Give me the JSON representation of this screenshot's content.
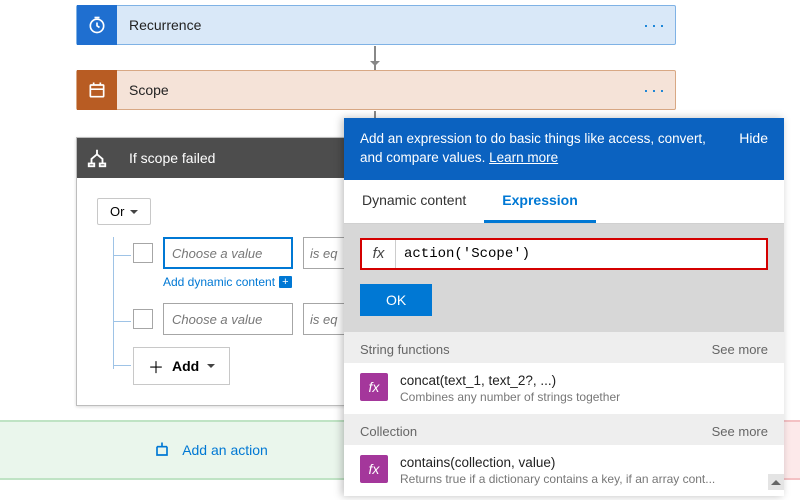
{
  "flow": {
    "recurrence_label": "Recurrence",
    "scope_label": "Scope"
  },
  "condition": {
    "title": "If scope failed",
    "or_label": "Or",
    "value_placeholder": "Choose a value",
    "op_placeholder": "is eq",
    "add_dynamic_label": "Add dynamic content",
    "add_row_label": "Add"
  },
  "bottom": {
    "add_action_label": "Add an action"
  },
  "expr_panel": {
    "banner_msg": "Add an expression to do basic things like access, convert, and compare values. ",
    "learn_more": "Learn more",
    "hide_label": "Hide",
    "tabs": {
      "dynamic": "Dynamic content",
      "expression": "Expression"
    },
    "fx_label": "fx",
    "expr_value": "action('Scope')",
    "ok_label": "OK",
    "sections": [
      {
        "title": "String functions",
        "see_more": "See more",
        "item": {
          "name": "concat(text_1, text_2?, ...)",
          "desc": "Combines any number of strings together"
        }
      },
      {
        "title": "Collection",
        "see_more": "See more",
        "item": {
          "name": "contains(collection, value)",
          "desc": "Returns true if a dictionary contains a key, if an array cont..."
        }
      }
    ]
  }
}
